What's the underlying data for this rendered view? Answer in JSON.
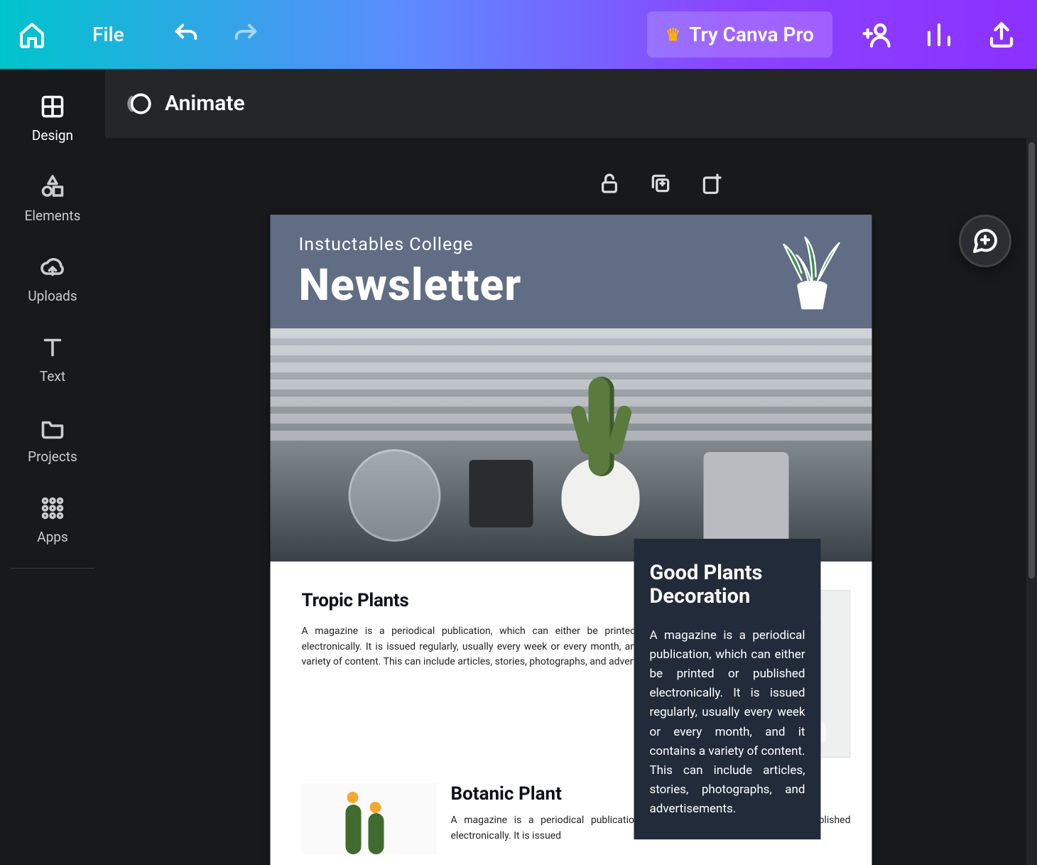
{
  "topbar": {
    "file_label": "File",
    "try_pro_label": "Try Canva Pro"
  },
  "sidebar": {
    "items": [
      {
        "label": "Design"
      },
      {
        "label": "Elements"
      },
      {
        "label": "Uploads"
      },
      {
        "label": "Text"
      },
      {
        "label": "Projects"
      },
      {
        "label": "Apps"
      }
    ]
  },
  "secondary": {
    "animate_label": "Animate"
  },
  "design": {
    "header_subtitle": "Instuctables College",
    "header_title": "Newsletter",
    "article1": {
      "heading": "Tropic Plants",
      "body": "A magazine is a periodical publication, which can either be printed or published electronically. It is issued regularly, usually every week or every month, and it contains a variety of content. This can include articles, stories, photographs, and advertisements."
    },
    "article2": {
      "heading": "Botanic Plant",
      "body": "A magazine is a periodical publication, which can either be printed or published electronically. It is issued"
    },
    "right_panel": {
      "heading": "Good Plants Decoration",
      "body": "A magazine is a periodical publication, which can either be printed or published electronically. It is issued regularly, usually every week or every month, and it contains a variety of content. This can include articles, stories, photographs, and advertisements."
    }
  }
}
